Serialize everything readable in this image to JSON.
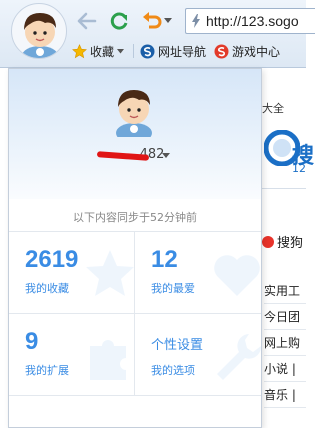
{
  "toolbar": {
    "url": "http://123.sogo"
  },
  "bookmarks": [
    {
      "label": "收藏",
      "icon": "star-icon"
    },
    {
      "label": "网址导航",
      "icon": "sogou-nav-icon"
    },
    {
      "label": "游戏中心",
      "icon": "game-icon"
    }
  ],
  "background_page": {
    "tab_text": "大全",
    "brand": "搜",
    "brand_sub": "12",
    "search_text": "搜狗",
    "links": [
      "实用工",
      "今日团",
      "网上购",
      "小说 |",
      "音乐 |"
    ]
  },
  "panel": {
    "username_suffix": "482",
    "sync_text": "以下内容同步于52分钟前",
    "cells": [
      {
        "value": "2619",
        "label": "我的收藏",
        "icon": "star-icon"
      },
      {
        "value": "12",
        "label": "我的最爱",
        "icon": "heart-icon"
      },
      {
        "value": "9",
        "label": "我的扩展",
        "icon": "puzzle-icon"
      },
      {
        "value": "个性设置",
        "label": "我的选项",
        "icon": "wrench-icon"
      }
    ]
  },
  "colors": {
    "accent": "#3a8ce4",
    "toolbar_bg": "#e3ecf7",
    "redaction": "#e01515"
  }
}
